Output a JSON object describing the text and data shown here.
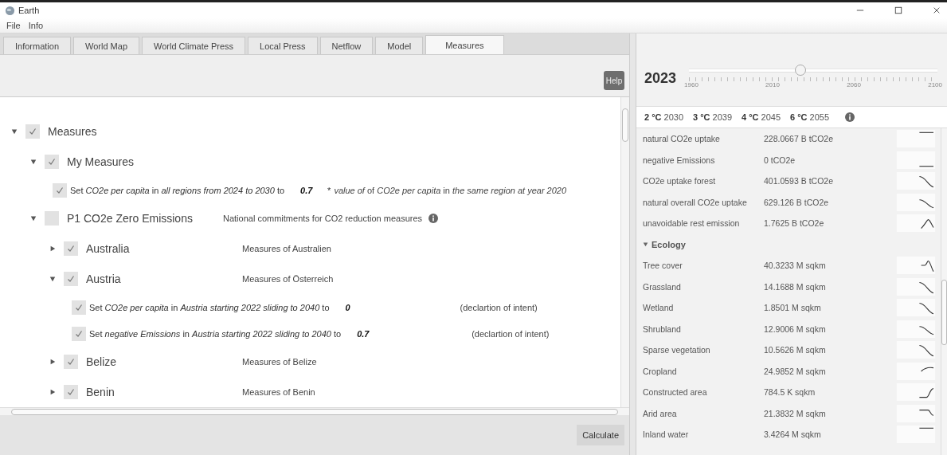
{
  "window": {
    "title": "Earth"
  },
  "menu": [
    "File",
    "Info"
  ],
  "tabs": [
    {
      "label": "Information",
      "selected": false
    },
    {
      "label": "World Map",
      "selected": false
    },
    {
      "label": "World Climate Press",
      "selected": false
    },
    {
      "label": "Local Press",
      "selected": false
    },
    {
      "label": "Netflow",
      "selected": false
    },
    {
      "label": "Model",
      "selected": false
    },
    {
      "label": "Measures",
      "selected": true
    }
  ],
  "help_button": "Help",
  "tree": [
    {
      "kind": "group",
      "label": "Measures",
      "checked": true,
      "expanded": true,
      "children": [
        {
          "kind": "group",
          "label": "My Measures",
          "checked": true,
          "expanded": true,
          "children": [
            {
              "kind": "measure",
              "checked": true,
              "text": "Set *CO2e per capita* in *all regions from 2024 to 2030* to",
              "value": "0.7",
              "focused": false,
              "mark": "*",
              "note": "*value of* of *CO2e per capita* in *the same region at year 2020*"
            }
          ]
        },
        {
          "kind": "group",
          "label": "P1 CO2e Zero Emissions",
          "checked": false,
          "expanded": true,
          "description": "National commitments for CO2 reduction measures",
          "info": true,
          "children": [
            {
              "kind": "group",
              "label": "Australia",
              "checked": true,
              "expanded": false,
              "description": "Measures of Australien"
            },
            {
              "kind": "group",
              "label": "Austria",
              "checked": true,
              "expanded": true,
              "description": "Measures of Österreich",
              "children": [
                {
                  "kind": "measure",
                  "checked": true,
                  "text": "Set *CO2e per capita* in *Austria starting 2022 sliding to 2040* to",
                  "value": "0",
                  "focused": true,
                  "note": "(declartion of intent)"
                },
                {
                  "kind": "measure",
                  "checked": true,
                  "text": "Set *negative Emissions* in *Austria starting 2022 sliding to 2040* to",
                  "value": "0.7",
                  "focused": false,
                  "note": "(declartion of intent)"
                }
              ]
            },
            {
              "kind": "group",
              "label": "Belize",
              "checked": true,
              "expanded": false,
              "description": "Measures of Belize"
            },
            {
              "kind": "group",
              "label": "Benin",
              "checked": true,
              "expanded": false,
              "description": "Measures of Benin"
            }
          ]
        }
      ]
    }
  ],
  "calculate_button": "Calculate",
  "year": {
    "value": "2023",
    "level": 0.45,
    "ticks": [
      "1960",
      "2010",
      "2060",
      "2100"
    ]
  },
  "thresholds": [
    {
      "degrees": "2 °C",
      "year": "2030"
    },
    {
      "degrees": "3 °C",
      "year": "2039"
    },
    {
      "degrees": "4 °C",
      "year": "2045"
    },
    {
      "degrees": "6 °C",
      "year": "2055"
    }
  ],
  "stats": [
    {
      "kind": "row",
      "label": "natural CO2e uptake",
      "value": "228.0667 B tCO2e"
    },
    {
      "kind": "row",
      "label": "negative Emissions",
      "value": "0 tCO2e"
    },
    {
      "kind": "row",
      "label": "CO2e uptake forest",
      "value": "401.0593 B tCO2e"
    },
    {
      "kind": "row",
      "label": "natural overall CO2e uptake",
      "value": "629.126 B tCO2e"
    },
    {
      "kind": "row",
      "label": "unavoidable rest emission",
      "value": "1.7625 B tCO2e"
    },
    {
      "kind": "header",
      "label": "Ecology",
      "expanded": true
    },
    {
      "kind": "row",
      "label": "Tree cover",
      "value": "40.3233 M sqkm"
    },
    {
      "kind": "row",
      "label": "Grassland",
      "value": "14.1688 M sqkm"
    },
    {
      "kind": "row",
      "label": "Wetland",
      "value": "1.8501 M sqkm"
    },
    {
      "kind": "row",
      "label": "Shrubland",
      "value": "12.9006 M sqkm"
    },
    {
      "kind": "row",
      "label": "Sparse vegetation",
      "value": "10.5626 M sqkm"
    },
    {
      "kind": "row",
      "label": "Cropland",
      "value": "24.9852 M sqkm"
    },
    {
      "kind": "row",
      "label": "Constructed area",
      "value": "784.5 K sqkm"
    },
    {
      "kind": "row",
      "label": "Arid area",
      "value": "21.3832 M sqkm"
    },
    {
      "kind": "row",
      "label": "Inland water",
      "value": "3.4264 M sqkm"
    }
  ]
}
